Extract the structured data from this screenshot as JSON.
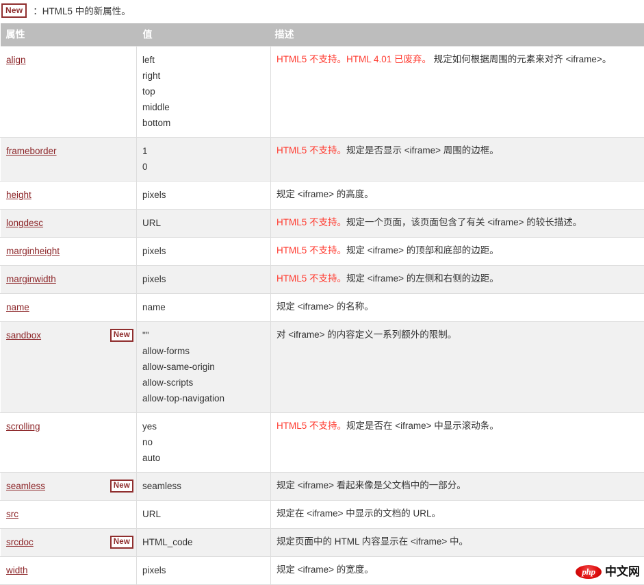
{
  "legend": {
    "badge_label": "New",
    "text": "：HTML5 中的新属性。"
  },
  "table": {
    "columns": [
      "属性",
      "值",
      "描述"
    ],
    "rows": [
      {
        "attribute": "align",
        "badge": "",
        "values": [
          "left",
          "right",
          "top",
          "middle",
          "bottom"
        ],
        "desc_warn": "HTML5 不支持。HTML 4.01 已废弃。",
        "desc_rest": " 规定如何根据周围的元素来对齐 <iframe>。"
      },
      {
        "attribute": "frameborder",
        "badge": "",
        "values": [
          "1",
          "0"
        ],
        "desc_warn": "HTML5 不支持。",
        "desc_rest": "规定是否显示 <iframe> 周围的边框。"
      },
      {
        "attribute": "height",
        "badge": "",
        "values": [
          "pixels"
        ],
        "desc_warn": "",
        "desc_rest": "规定 <iframe> 的高度。"
      },
      {
        "attribute": "longdesc",
        "badge": "",
        "values": [
          "URL"
        ],
        "desc_warn": "HTML5 不支持。",
        "desc_rest": "规定一个页面，该页面包含了有关 <iframe> 的较长描述。"
      },
      {
        "attribute": "marginheight",
        "badge": "",
        "values": [
          "pixels"
        ],
        "desc_warn": "HTML5 不支持。",
        "desc_rest": "规定 <iframe> 的顶部和底部的边距。"
      },
      {
        "attribute": "marginwidth",
        "badge": "",
        "values": [
          "pixels"
        ],
        "desc_warn": "HTML5 不支持。",
        "desc_rest": "规定 <iframe> 的左侧和右侧的边距。"
      },
      {
        "attribute": "name",
        "badge": "",
        "values": [
          "name"
        ],
        "desc_warn": "",
        "desc_rest": "规定 <iframe> 的名称。"
      },
      {
        "attribute": "sandbox",
        "badge": "New",
        "values": [
          "\"\"",
          "allow-forms",
          "allow-same-origin",
          "allow-scripts",
          "allow-top-navigation"
        ],
        "desc_warn": "",
        "desc_rest": "对 <iframe> 的内容定义一系列额外的限制。"
      },
      {
        "attribute": "scrolling",
        "badge": "",
        "values": [
          "yes",
          "no",
          "auto"
        ],
        "desc_warn": "HTML5 不支持。",
        "desc_rest": "规定是否在 <iframe> 中显示滚动条。"
      },
      {
        "attribute": "seamless",
        "badge": "New",
        "values": [
          "seamless"
        ],
        "desc_warn": "",
        "desc_rest": "规定 <iframe> 看起来像是父文档中的一部分。"
      },
      {
        "attribute": "src",
        "badge": "",
        "values": [
          "URL"
        ],
        "desc_warn": "",
        "desc_rest": "规定在 <iframe> 中显示的文档的 URL。"
      },
      {
        "attribute": "srcdoc",
        "badge": "New",
        "values": [
          "HTML_code"
        ],
        "desc_warn": "",
        "desc_rest": "规定页面中的 HTML 内容显示在 <iframe> 中。"
      },
      {
        "attribute": "width",
        "badge": "",
        "values": [
          "pixels"
        ],
        "desc_warn": "",
        "desc_rest": "规定 <iframe> 的宽度。"
      }
    ]
  },
  "watermark": {
    "logo_text": "php",
    "site_text": "中文网"
  },
  "colors": {
    "header_bg": "#bdbdbd",
    "alt_row_bg": "#f1f1f1",
    "link": "#8b2326",
    "warn": "#ff3b30",
    "badge_border": "#8f2e2e"
  }
}
